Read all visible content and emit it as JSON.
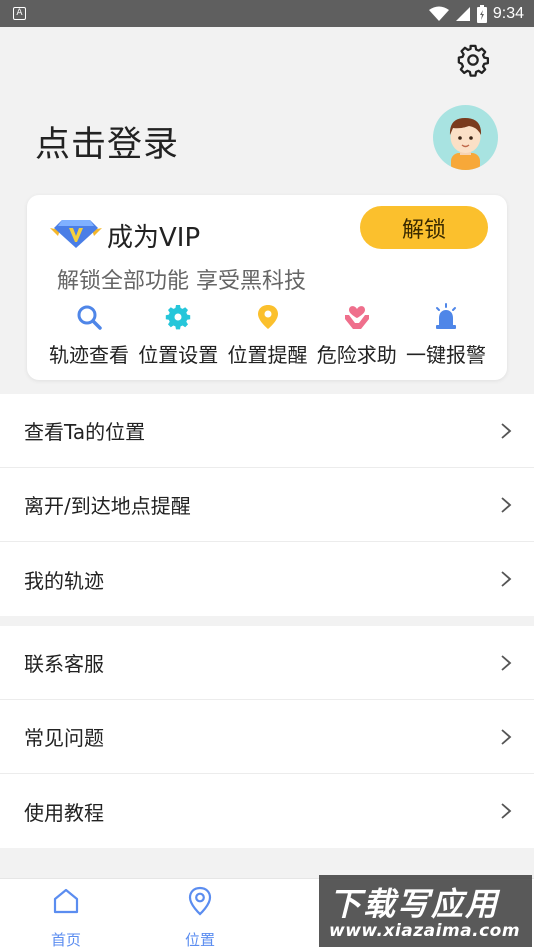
{
  "status_bar": {
    "app_indicator": "A",
    "time": "9:34"
  },
  "header": {
    "login_label": "点击登录"
  },
  "vip_card": {
    "title": "成为VIP",
    "unlock_button": "解锁",
    "subtitle": "解锁全部功能 享受黑科技",
    "features": [
      {
        "label": "轨迹查看",
        "icon": "search-icon",
        "color": "#4f86e8"
      },
      {
        "label": "位置设置",
        "icon": "gear-icon",
        "color": "#26c6da"
      },
      {
        "label": "位置提醒",
        "icon": "location-pin-icon",
        "color": "#fbc02d"
      },
      {
        "label": "危险求助",
        "icon": "help-hands-icon",
        "color": "#ef6f8c"
      },
      {
        "label": "一键报警",
        "icon": "alarm-icon",
        "color": "#4f86e8"
      }
    ]
  },
  "menu_group_1": [
    {
      "label": "查看Ta的位置"
    },
    {
      "label": "离开/到达地点提醒"
    },
    {
      "label": "我的轨迹"
    }
  ],
  "menu_group_2": [
    {
      "label": "联系客服"
    },
    {
      "label": "常见问题"
    },
    {
      "label": "使用教程"
    }
  ],
  "tab_bar": {
    "tabs": [
      {
        "label": "首页",
        "icon": "home-icon"
      },
      {
        "label": "位置",
        "icon": "location-icon"
      }
    ]
  },
  "watermark": {
    "title": "下载写应用",
    "url": "www.xiazaima.com"
  },
  "colors": {
    "accent": "#5b8df0",
    "vip_yellow": "#fbc02d",
    "avatar_bg": "#a8e3e1"
  }
}
